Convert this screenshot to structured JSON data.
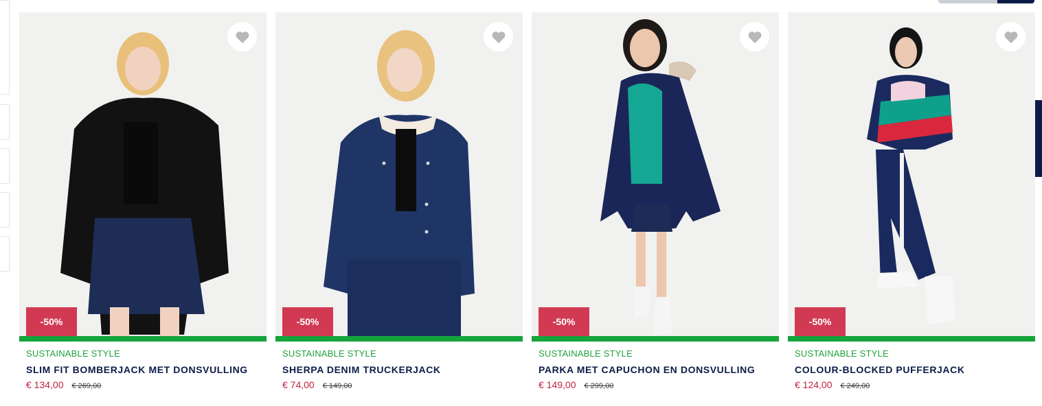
{
  "colors": {
    "sale_badge": "#d23a54",
    "sustainable_bar": "#15a43c",
    "sustainable_text": "#1ea33a",
    "title_text": "#0c1c47",
    "price_now": "#c2233f"
  },
  "products": [
    {
      "badge": "-50%",
      "tag": "SUSTAINABLE STYLE",
      "title": "SLIM FIT BOMBERJACK MET DONSVULLING",
      "price_now": "€ 134,00",
      "price_old": "€ 269,00",
      "wishlist_icon": "heart-icon",
      "jacket_color": "#121212"
    },
    {
      "badge": "-50%",
      "tag": "SUSTAINABLE STYLE",
      "title": "SHERPA DENIM TRUCKERJACK",
      "price_now": "€ 74,00",
      "price_old": "€ 149,00",
      "wishlist_icon": "heart-icon",
      "jacket_color": "#1f3566"
    },
    {
      "badge": "-50%",
      "tag": "SUSTAINABLE STYLE",
      "title": "PARKA MET CAPUCHON EN DONSVULLING",
      "price_now": "€ 149,00",
      "price_old": "€ 299,00",
      "wishlist_icon": "heart-icon",
      "jacket_color": "#1b2658"
    },
    {
      "badge": "-50%",
      "tag": "SUSTAINABLE STYLE",
      "title": "COLOUR-BLOCKED PUFFERJACK",
      "price_now": "€ 124,00",
      "price_old": "€ 249,00",
      "wishlist_icon": "heart-icon",
      "jacket_color": "#1a2a5e"
    }
  ]
}
